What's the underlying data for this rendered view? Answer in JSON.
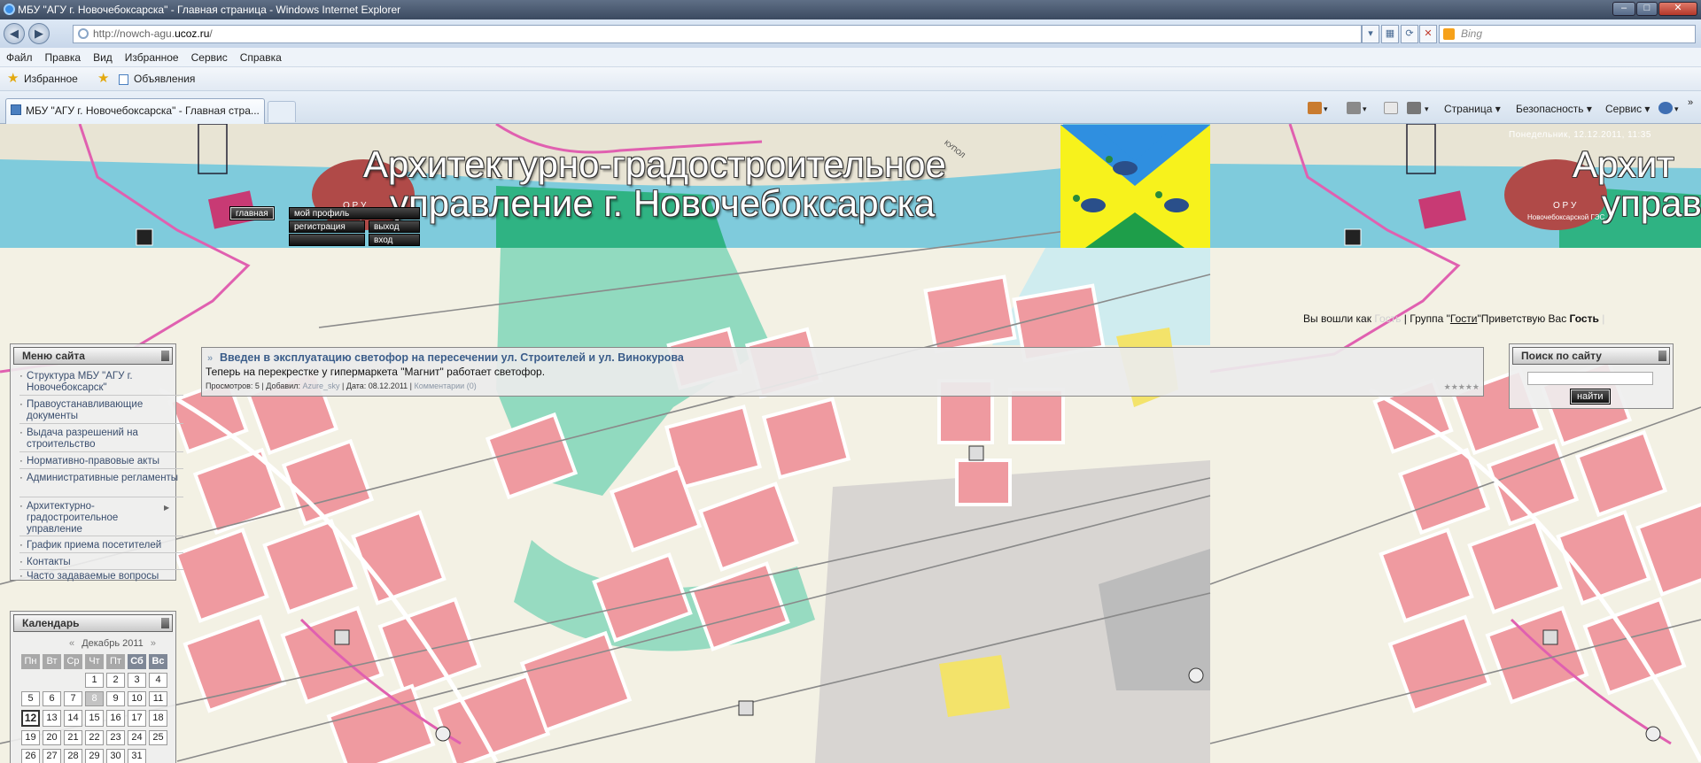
{
  "window": {
    "title": "МБУ \"АГУ г. Новочебоксарска\" - Главная страница - Windows Internet Explorer",
    "minimize": "–",
    "maximize": "□",
    "close": "✕"
  },
  "address": {
    "prefix": "http://nowch-agu.",
    "domain": "ucoz.ru",
    "suffix": "/",
    "search_placeholder": "Bing"
  },
  "menu": [
    "Файл",
    "Правка",
    "Вид",
    "Избранное",
    "Сервис",
    "Справка"
  ],
  "favorites": {
    "label": "Избранное",
    "link": "Объявления"
  },
  "tab": {
    "label": "МБУ \"АГУ г. Новочебоксарска\" - Главная стра..."
  },
  "commands": {
    "page": "Страница ▾",
    "safety": "Безопасность ▾",
    "tools": "Сервис ▾"
  },
  "site": {
    "header_line1": "Архитектурно-градостроительное",
    "header_line2": "управление г. Новочебоксарска",
    "header_repeat": "Архит",
    "header_repeat2": "управ",
    "datetime": "Понедельник, 12.12.2011, 11:35",
    "nav": {
      "home": "главная",
      "profile": "мой профиль",
      "register": "регистрация",
      "logout": "выход",
      "login": "вход"
    },
    "login_line": {
      "part1": "Вы вошли как ",
      "guest_light": "Гость",
      "part2": " | Группа \"",
      "group": "Гости",
      "part3": "\"Приветствую Вас ",
      "guest_bold": "Гость"
    },
    "map_labels": {
      "oru": "О Р У",
      "ges": "Новочебоксарской ГЭС",
      "kupol": "КУПОЛ"
    }
  },
  "site_menu": {
    "title": "Меню сайта",
    "items": [
      "Структура МБУ \"АГУ г. Новочебоксарск\"",
      "Правоустанавливающие документы",
      "Выдача разрешений на строительство",
      "Нормативно-правовые акты",
      "Административные регламенты",
      "Архитектурно-градостроительное управление",
      "График приема посетителей",
      "Контакты",
      "Часто задаваемые вопросы"
    ]
  },
  "calendar": {
    "title": "Календарь",
    "prev": "«",
    "month": "Декабрь 2011",
    "next": "»",
    "days": [
      "Пн",
      "Вт",
      "Ср",
      "Чт",
      "Пт",
      "Сб",
      "Вс"
    ],
    "weeks": [
      [
        "",
        "",
        "",
        "1",
        "2",
        "3",
        "4"
      ],
      [
        "5",
        "6",
        "7",
        "8",
        "9",
        "10",
        "11"
      ],
      [
        "12",
        "13",
        "14",
        "15",
        "16",
        "17",
        "18"
      ],
      [
        "19",
        "20",
        "21",
        "22",
        "23",
        "24",
        "25"
      ],
      [
        "26",
        "27",
        "28",
        "29",
        "30",
        "31",
        ""
      ]
    ],
    "today": "12",
    "link_day": "8"
  },
  "news": {
    "arrow": "»",
    "title": "Введен в эксплуатацию светофор на пересечении ул. Строителей и ул. Винокурова",
    "text": "Теперь на перекрестке у гипермаркета \"Магнит\" работает светофор.",
    "views": "Просмотров: 5",
    "added_label": "Добавил:",
    "author": "Azure_sky",
    "date": "Дата: 08.12.2011",
    "comments": "Комментарии (0)"
  },
  "search": {
    "title": "Поиск по сайту",
    "button": "найти"
  },
  "colors": {
    "map_block": "#ef9aa0",
    "map_green": "#7fd6b8",
    "header_sky": "#7fcbdc",
    "coat_blue": "#2f8fe0",
    "coat_yellow": "#f7f21c",
    "coat_green": "#1e9e4a",
    "link_blue": "#3b5d8a"
  }
}
